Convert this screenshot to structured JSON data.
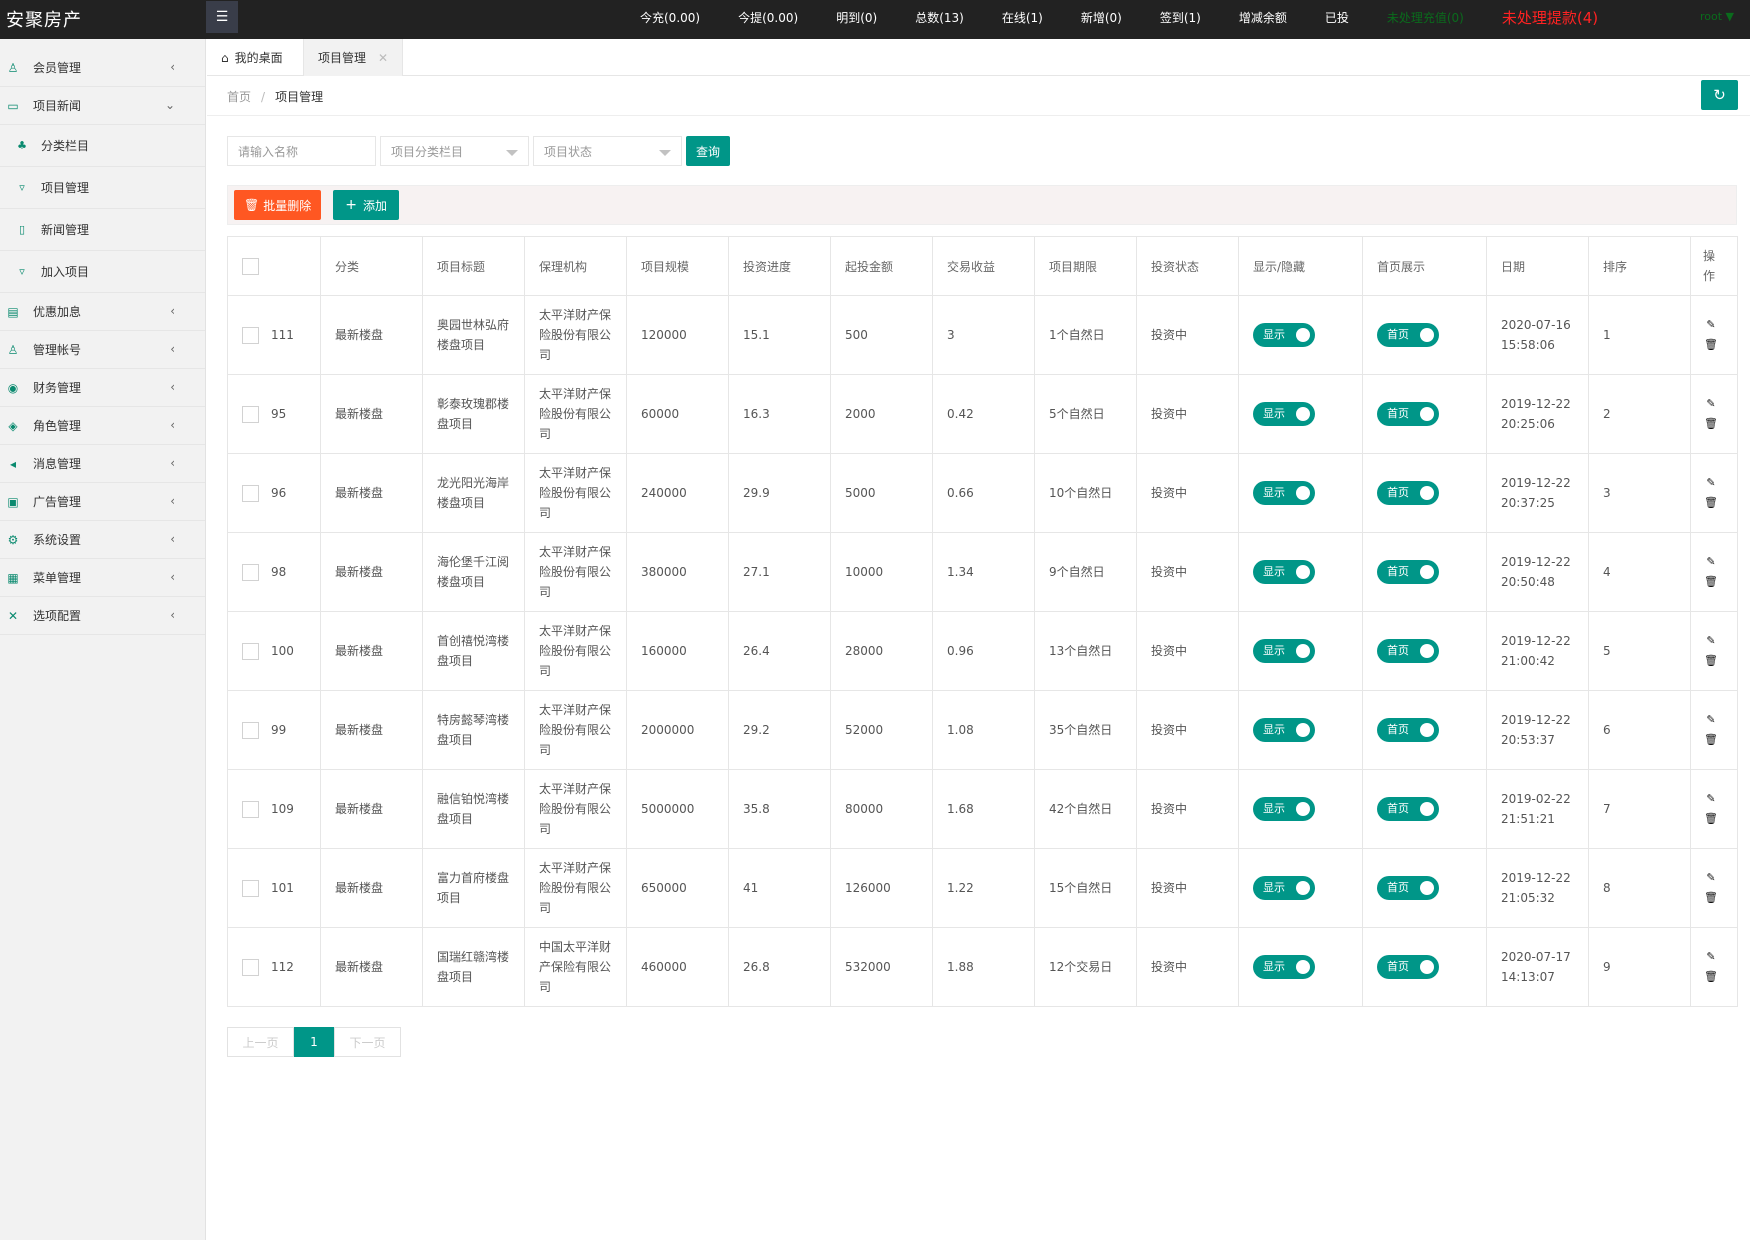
{
  "app": {
    "logo": "安聚房产",
    "user": "root",
    "user_caret": "▼"
  },
  "topbar": {
    "stats": [
      "今充(0.00)",
      "今提(0.00)",
      "明到(0)",
      "总数(13)",
      "在线(1)",
      "新增(0)",
      "签到(1)",
      "增减余额",
      "已投"
    ],
    "pending_recharge": "未处理充值(0)",
    "pending_withdraw": "未处理提款(4)"
  },
  "sidebar": {
    "items": [
      {
        "label": "会员管理",
        "icon": "user-icon"
      },
      {
        "label": "项目新闻",
        "icon": "car-icon",
        "expanded": true
      },
      {
        "label": "优惠加息",
        "icon": "ticket-icon"
      },
      {
        "label": "管理帐号",
        "icon": "users-icon"
      },
      {
        "label": "财务管理",
        "icon": "money-icon"
      },
      {
        "label": "角色管理",
        "icon": "shield-icon"
      },
      {
        "label": "消息管理",
        "icon": "speaker-icon"
      },
      {
        "label": "广告管理",
        "icon": "ad-icon"
      },
      {
        "label": "系统设置",
        "icon": "gear-icon"
      },
      {
        "label": "菜单管理",
        "icon": "grid-icon"
      },
      {
        "label": "选项配置",
        "icon": "tools-icon"
      }
    ],
    "subitems": [
      {
        "label": "分类栏目",
        "icon": "tree-icon"
      },
      {
        "label": "项目管理",
        "icon": "cart-icon"
      },
      {
        "label": "新闻管理",
        "icon": "file-icon"
      },
      {
        "label": "加入项目",
        "icon": "cart-icon"
      }
    ]
  },
  "tabs": {
    "home": "我的桌面",
    "current": "项目管理",
    "close": "✕"
  },
  "breadcrumb": {
    "home": "首页",
    "sep": "/",
    "current": "项目管理"
  },
  "search": {
    "name_placeholder": "请输入名称",
    "category_placeholder": "项目分类栏目",
    "status_placeholder": "项目状态",
    "query_label": "查询"
  },
  "toolbar": {
    "delete_label": "批量删除",
    "add_label": "添加"
  },
  "table": {
    "headers": [
      "分类",
      "项目标题",
      "保理机构",
      "项目规模",
      "投资进度",
      "起投金额",
      "交易收益",
      "项目期限",
      "投资状态",
      "显示/隐藏",
      "首页展示",
      "日期",
      "排序",
      "操作"
    ],
    "rows": [
      {
        "id": "111",
        "category": "最新楼盘",
        "title": "奥园世林弘府楼盘项目",
        "agency": "太平洋财产保险股份有限公司",
        "scale": "120000",
        "progress": "15.1",
        "min": "500",
        "yield": "3",
        "term": "1个自然日",
        "status": "投资中",
        "show": "显示",
        "home": "首页",
        "date1": "2020-07-16",
        "date2": "15:58:06",
        "sort": "1"
      },
      {
        "id": "95",
        "category": "最新楼盘",
        "title": "彰泰玫瑰郡楼盘项目",
        "agency": "太平洋财产保险股份有限公司",
        "scale": "60000",
        "progress": "16.3",
        "min": "2000",
        "yield": "0.42",
        "term": "5个自然日",
        "status": "投资中",
        "show": "显示",
        "home": "首页",
        "date1": "2019-12-22",
        "date2": "20:25:06",
        "sort": "2"
      },
      {
        "id": "96",
        "category": "最新楼盘",
        "title": "龙光阳光海岸楼盘项目",
        "agency": "太平洋财产保险股份有限公司",
        "scale": "240000",
        "progress": "29.9",
        "min": "5000",
        "yield": "0.66",
        "term": "10个自然日",
        "status": "投资中",
        "show": "显示",
        "home": "首页",
        "date1": "2019-12-22",
        "date2": "20:37:25",
        "sort": "3"
      },
      {
        "id": "98",
        "category": "最新楼盘",
        "title": "海伦堡千江阅楼盘项目",
        "agency": "太平洋财产保险股份有限公司",
        "scale": "380000",
        "progress": "27.1",
        "min": "10000",
        "yield": "1.34",
        "term": "9个自然日",
        "status": "投资中",
        "show": "显示",
        "home": "首页",
        "date1": "2019-12-22",
        "date2": "20:50:48",
        "sort": "4"
      },
      {
        "id": "100",
        "category": "最新楼盘",
        "title": "首创禧悦湾楼盘项目",
        "agency": "太平洋财产保险股份有限公司",
        "scale": "160000",
        "progress": "26.4",
        "min": "28000",
        "yield": "0.96",
        "term": "13个自然日",
        "status": "投资中",
        "show": "显示",
        "home": "首页",
        "date1": "2019-12-22",
        "date2": "21:00:42",
        "sort": "5"
      },
      {
        "id": "99",
        "category": "最新楼盘",
        "title": "特房懿琴湾楼盘项目",
        "agency": "太平洋财产保险股份有限公司",
        "scale": "2000000",
        "progress": "29.2",
        "min": "52000",
        "yield": "1.08",
        "term": "35个自然日",
        "status": "投资中",
        "show": "显示",
        "home": "首页",
        "date1": "2019-12-22",
        "date2": "20:53:37",
        "sort": "6"
      },
      {
        "id": "109",
        "category": "最新楼盘",
        "title": "融信铂悦湾楼盘项目",
        "agency": "太平洋财产保险股份有限公司",
        "scale": "5000000",
        "progress": "35.8",
        "min": "80000",
        "yield": "1.68",
        "term": "42个自然日",
        "status": "投资中",
        "show": "显示",
        "home": "首页",
        "date1": "2019-02-22",
        "date2": "21:51:21",
        "sort": "7"
      },
      {
        "id": "101",
        "category": "最新楼盘",
        "title": "富力首府楼盘项目",
        "agency": "太平洋财产保险股份有限公司",
        "scale": "650000",
        "progress": "41",
        "min": "126000",
        "yield": "1.22",
        "term": "15个自然日",
        "status": "投资中",
        "show": "显示",
        "home": "首页",
        "date1": "2019-12-22",
        "date2": "21:05:32",
        "sort": "8"
      },
      {
        "id": "112",
        "category": "最新楼盘",
        "title": "国瑞红赣湾楼盘项目",
        "agency": "中国太平洋财产保险有限公司",
        "scale": "460000",
        "progress": "26.8",
        "min": "532000",
        "yield": "1.88",
        "term": "12个交易日",
        "status": "投资中",
        "show": "显示",
        "home": "首页",
        "date1": "2020-07-17",
        "date2": "14:13:07",
        "sort": "9"
      }
    ]
  },
  "pager": {
    "prev": "上一页",
    "current": "1",
    "next": "下一页"
  },
  "colors": {
    "accent": "#009688",
    "danger": "#ff5722",
    "topbar": "#222222",
    "alert": "#ff2222",
    "ok": "#0a6b1c"
  }
}
